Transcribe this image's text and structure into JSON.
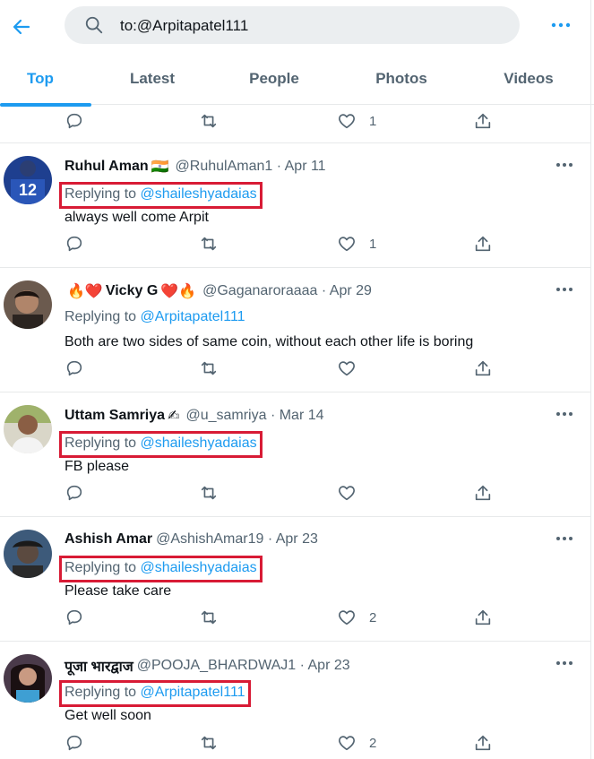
{
  "search": {
    "query": "to:@Arpitapatel111"
  },
  "tabs": [
    {
      "label": "Top",
      "active": true
    },
    {
      "label": "Latest",
      "active": false
    },
    {
      "label": "People",
      "active": false
    },
    {
      "label": "Photos",
      "active": false
    },
    {
      "label": "Videos",
      "active": false
    }
  ],
  "colors": {
    "accent": "#1d9bf0",
    "highlight_box": "#d81b35",
    "muted": "#536471",
    "search_bg": "#ebeef0"
  },
  "top_partial": {
    "like_count": "1"
  },
  "tweets": [
    {
      "name": "Ruhul Aman",
      "name_suffix_emoji": "🇮🇳",
      "handle_date": "@RuhulAman1 · Apr 11",
      "reply_prefix": "Replying to",
      "reply_to": "@shaileshyadaias",
      "text": "always well come Arpit",
      "like_count": "1"
    },
    {
      "name_prefix_emoji": "🔥❤️",
      "name": "Vicky G",
      "name_suffix_emoji": "❤️🔥",
      "handle_date": "@Gaganaroraaaa · Apr 29",
      "reply_prefix": "Replying to",
      "reply_to": "@Arpitapatel111",
      "text": "Both are two sides of same coin, without each other life is boring",
      "like_count": ""
    },
    {
      "name": "Uttam Samriya",
      "name_suffix_emoji": "✍",
      "handle_date": "@u_samriya · Mar 14",
      "reply_prefix": "Replying to",
      "reply_to": "@shaileshyadaias",
      "text": "FB please",
      "like_count": ""
    },
    {
      "name": "Ashish Amar",
      "handle_date": "@AshishAmar19 · Apr 23",
      "reply_prefix": "Replying to",
      "reply_to": "@shaileshyadaias",
      "text": "Please take care",
      "like_count": "2"
    },
    {
      "name": "पूजा भारद्वाज",
      "handle_date": "@POOJA_BHARDWAJ1 · Apr 23",
      "reply_prefix": "Replying to",
      "reply_to": "@Arpitapatel111",
      "text": "Get well soon",
      "like_count": "2"
    }
  ]
}
